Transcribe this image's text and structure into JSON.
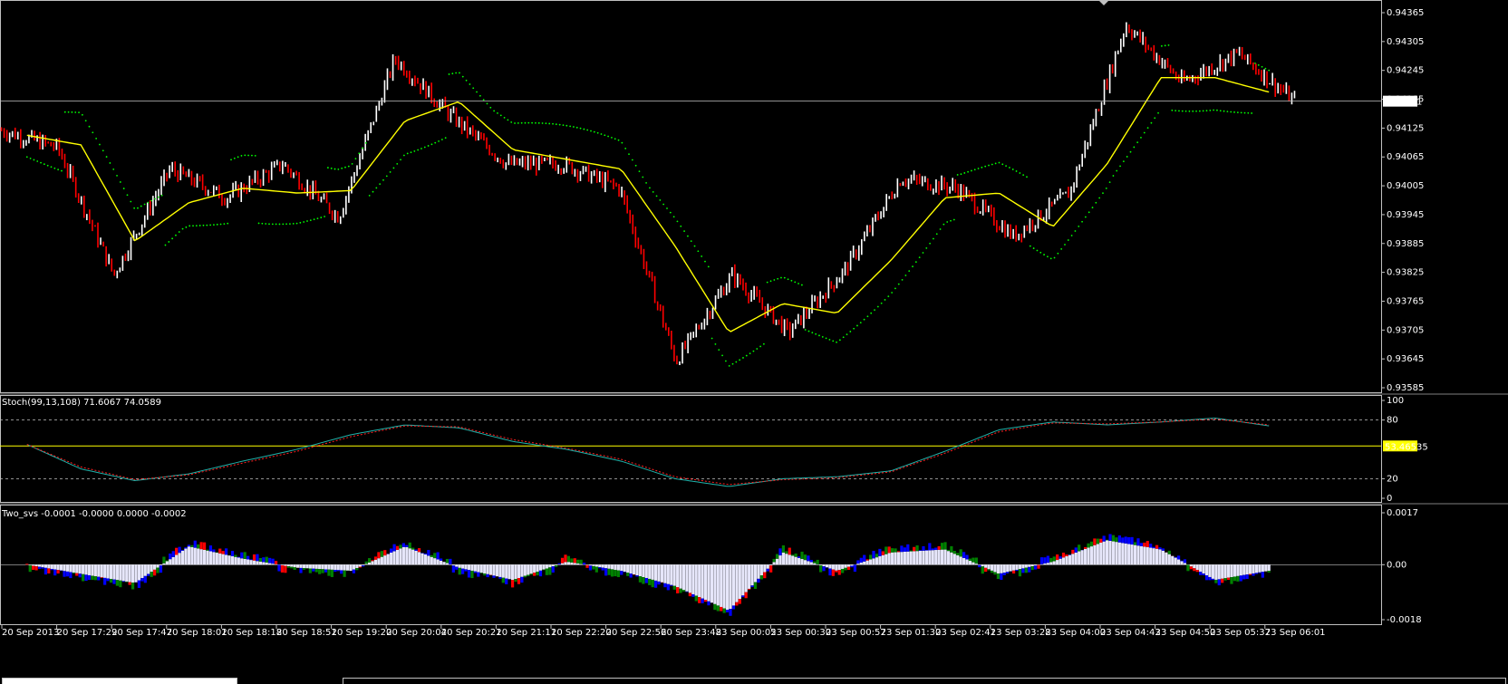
{
  "colors": {
    "background": "#000000",
    "border": "#c0c0c0",
    "bull_bar": "#ffffff",
    "bear_bar": "#ff0000",
    "moving_average": "#ffff00",
    "trailing_dots": "#00ff00",
    "stoch_main": "#20b2aa",
    "stoch_signal": "#ff2020",
    "level_line": "#ffff00",
    "ao_positive": "#e6e6fa",
    "ao_blue": "#0000ff",
    "ao_green": "#008000",
    "ao_red": "#ff0000"
  },
  "main": {
    "price_ticks": [
      "0.94365",
      "0.94305",
      "0.94245",
      "0.94185",
      "0.94125",
      "0.94065",
      "0.94005",
      "0.93945",
      "0.93885",
      "0.93825",
      "0.93765",
      "0.93705",
      "0.93645",
      "0.93585"
    ],
    "current_price": "0.94181"
  },
  "stoch": {
    "label": "Stoch(99,13,108) 71.6067 74.0589",
    "ticks": [
      "100",
      "80",
      "20",
      "0"
    ],
    "level_value": "53.46535"
  },
  "ao": {
    "label": "Two_svs -0.0001 -0.0000 0.0000 -0.0002",
    "ticks": [
      "0.0017",
      "0.00",
      "-0.0018"
    ]
  },
  "time_labels": [
    "20 Sep 2013",
    "20 Sep 17:29",
    "20 Sep 17:47",
    "20 Sep 18:01",
    "20 Sep 18:18",
    "20 Sep 18:51",
    "20 Sep 19:20",
    "20 Sep 20:04",
    "20 Sep 20:21",
    "20 Sep 21:11",
    "20 Sep 22:20",
    "20 Sep 22:56",
    "20 Sep 23:48",
    "23 Sep 00:05",
    "23 Sep 00:30",
    "23 Sep 00:57",
    "23 Sep 01:30",
    "23 Sep 02:41",
    "23 Sep 03:28",
    "23 Sep 04:00",
    "23 Sep 04:43",
    "23 Sep 04:50",
    "23 Sep 05:37",
    "23 Sep 06:01"
  ],
  "chart_data": [
    {
      "type": "line",
      "title": "",
      "ylim": [
        0.93585,
        0.94365
      ],
      "x": [
        "20 Sep 2013",
        "20 Sep 17:29",
        "20 Sep 17:47",
        "20 Sep 18:01",
        "20 Sep 18:18",
        "20 Sep 18:51",
        "20 Sep 19:20",
        "20 Sep 20:04",
        "20 Sep 20:21",
        "20 Sep 21:11",
        "20 Sep 22:20",
        "20 Sep 22:56",
        "20 Sep 23:48",
        "23 Sep 00:05",
        "23 Sep 00:30",
        "23 Sep 00:57",
        "23 Sep 01:30",
        "23 Sep 02:41",
        "23 Sep 03:28",
        "23 Sep 04:00",
        "23 Sep 04:43",
        "23 Sep 04:50",
        "23 Sep 05:37",
        "23 Sep 06:01"
      ],
      "series": [
        {
          "values": [
            0.9412,
            0.94085,
            0.9382,
            0.9404,
            0.9398,
            0.9405,
            0.9394,
            0.9427,
            0.9415,
            0.9405,
            0.9405,
            0.94,
            0.9364,
            0.9382,
            0.937,
            0.9383,
            0.9402,
            0.94,
            0.939,
            0.9399,
            0.9434,
            0.9422,
            0.9428,
            0.94181
          ]
        },
        {
          "values": [
            0.9411,
            0.9409,
            0.9389,
            0.9397,
            0.94,
            0.9399,
            0.93995,
            0.9414,
            0.9418,
            0.9408,
            0.9406,
            0.9404,
            0.9388,
            0.937,
            0.9376,
            0.9374,
            0.9385,
            0.9398,
            0.9399,
            0.9392,
            0.9405,
            0.9423,
            0.9423,
            0.942
          ]
        }
      ]
    },
    {
      "type": "line",
      "title": "Stoch(99,13,108) 71.6067 74.0589",
      "ylim": [
        0,
        100
      ],
      "x": [
        "20 Sep 2013",
        "20 Sep 17:29",
        "20 Sep 17:47",
        "20 Sep 18:01",
        "20 Sep 18:18",
        "20 Sep 18:51",
        "20 Sep 19:20",
        "20 Sep 20:04",
        "20 Sep 20:21",
        "20 Sep 21:11",
        "20 Sep 22:20",
        "20 Sep 22:56",
        "20 Sep 23:48",
        "23 Sep 00:05",
        "23 Sep 00:30",
        "23 Sep 00:57",
        "23 Sep 01:30",
        "23 Sep 02:41",
        "23 Sep 03:28",
        "23 Sep 04:00",
        "23 Sep 04:43",
        "23 Sep 04:50",
        "23 Sep 05:37",
        "23 Sep 06:01"
      ],
      "series": [
        {
          "values": [
            55,
            30,
            18,
            25,
            38,
            50,
            65,
            75,
            72,
            58,
            50,
            38,
            20,
            12,
            20,
            22,
            28,
            48,
            70,
            78,
            75,
            78,
            82,
            74
          ]
        },
        {
          "values": [
            55,
            32,
            19,
            24,
            36,
            48,
            63,
            74,
            73,
            60,
            51,
            40,
            22,
            14,
            19,
            21,
            27,
            46,
            68,
            77,
            76,
            78,
            81,
            75
          ]
        }
      ],
      "levels": [
        20,
        80,
        53.46535
      ]
    },
    {
      "type": "area",
      "title": "Two_svs -0.0001 -0.0000 0.0000 -0.0002",
      "ylim": [
        -0.0018,
        0.0017
      ],
      "x": [
        "20 Sep 2013",
        "20 Sep 17:29",
        "20 Sep 17:47",
        "20 Sep 18:01",
        "20 Sep 18:18",
        "20 Sep 18:51",
        "20 Sep 19:20",
        "20 Sep 20:04",
        "20 Sep 20:21",
        "20 Sep 21:11",
        "20 Sep 22:20",
        "20 Sep 22:56",
        "20 Sep 23:48",
        "23 Sep 00:05",
        "23 Sep 00:30",
        "23 Sep 00:57",
        "23 Sep 01:30",
        "23 Sep 02:41",
        "23 Sep 03:28",
        "23 Sep 04:00",
        "23 Sep 04:43",
        "23 Sep 04:50",
        "23 Sep 05:37",
        "23 Sep 06:01"
      ],
      "series": [
        {
          "values": [
            0.0,
            -0.0003,
            -0.0006,
            0.0006,
            0.0002,
            -0.0001,
            -0.0002,
            0.0006,
            -0.0001,
            -0.0005,
            0.0001,
            -0.0002,
            -0.0007,
            -0.0015,
            0.0004,
            -0.0002,
            0.0004,
            0.0005,
            -0.0003,
            0.0001,
            0.0008,
            0.0005,
            -0.0005,
            -0.0002
          ]
        }
      ]
    }
  ]
}
